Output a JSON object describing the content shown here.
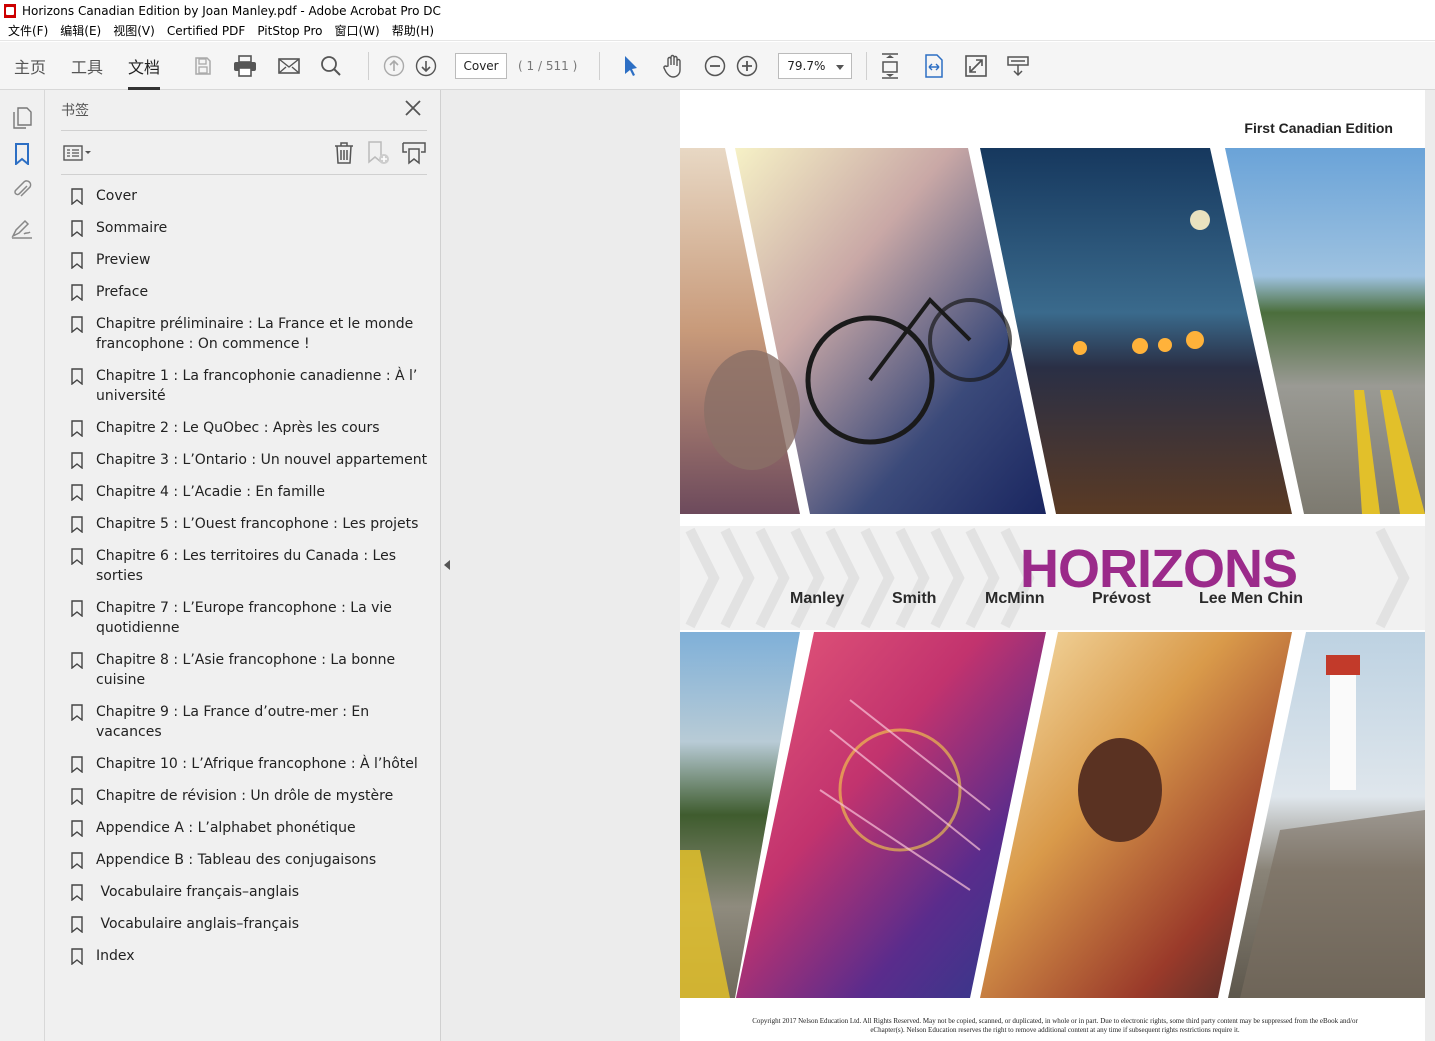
{
  "window": {
    "title": "Horizons Canadian Edition by Joan Manley.pdf - Adobe Acrobat Pro DC"
  },
  "menubar": {
    "items": [
      "文件(F)",
      "编辑(E)",
      "视图(V)",
      "Certified PDF",
      "PitStop Pro",
      "窗口(W)",
      "帮助(H)"
    ]
  },
  "toolbar": {
    "tabs": [
      "主页",
      "工具",
      "文档"
    ],
    "active_tab": "文档",
    "page_label": "Cover",
    "page_count": "( 1 / 511 )",
    "zoom": "79.7%"
  },
  "bookmarks_panel": {
    "title": "书签",
    "items": [
      "Cover",
      "Sommaire",
      "Preview",
      "Preface",
      "Chapitre préliminaire : La France et le monde francophone : On commence !",
      "Chapitre 1 : La francophonie canadienne : À l’ université",
      "Chapitre 2 : Le QuObec : Après les cours",
      "Chapitre 3 : L’Ontario : Un nouvel appartement",
      "Chapitre 4 : L’Acadie : En famille",
      "Chapitre 5 : L’Ouest francophone : Les projets",
      "Chapitre 6 : Les territoires du Canada : Les sorties",
      "Chapitre 7 : L’Europe francophone : La vie quotidienne",
      "Chapitre 8 : L’Asie francophone : La bonne cuisine",
      "Chapitre 9 : La France d’outre-mer : En vacances",
      "Chapitre 10 : L’Afrique francophone : À l’hôtel",
      "Chapitre de révision : Un drôle de mystère",
      "Appendice A : L’alphabet phonétique",
      "Appendice B : Tableau des conjugaisons",
      " Vocabulaire français–anglais",
      " Vocabulaire anglais–français",
      "Index"
    ]
  },
  "cover": {
    "edition": "First Canadian Edition",
    "title": "HORIZONS",
    "authors": [
      "Manley",
      "Smith",
      "McMinn",
      "Prévost",
      "Lee Men Chin"
    ],
    "copyright": "Copyright 2017 Nelson Education Ltd. All Rights Reserved. May not be copied, scanned, or duplicated, in whole or in part. Due to electronic rights, some third party content may be suppressed from the eBook and/or eChapter(s). Nelson Education reserves the right to remove additional content at any time if subsequent rights restrictions require it.",
    "title_color": "#9b2a8a"
  }
}
